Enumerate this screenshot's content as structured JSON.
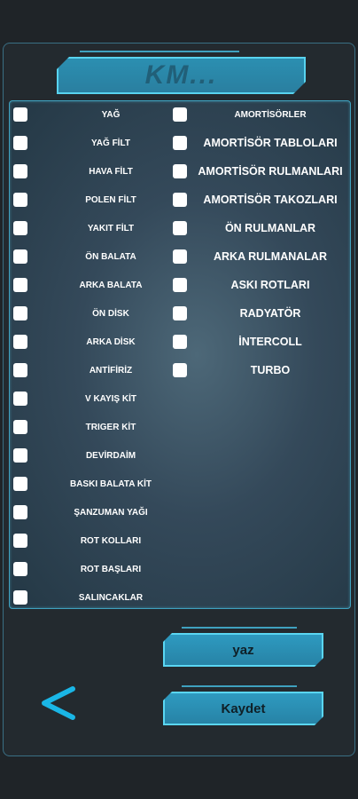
{
  "header": {
    "title": "KM..."
  },
  "left_items": [
    "YAĞ",
    "YAĞ FİLT",
    "HAVA FİLT",
    "POLEN FİLT",
    "YAKIT FİLT",
    "ÖN BALATA",
    "ARKA BALATA",
    "ÖN DİSK",
    "ARKA DİSK",
    "ANTİFİRİZ",
    "V KAYIŞ KİT",
    "TRIGER KİT",
    "DEVİRDAİM",
    "BASKI BALATA KİT",
    "ŞANZUMAN YAĞI",
    "ROT KOLLARI",
    "ROT BAŞLARI",
    "SALINCAKLAR"
  ],
  "right_items": [
    "AMORTİSÖRLER",
    "AMORTİSÖR TABLOLARI",
    "AMORTİSÖR RULMANLARI",
    "AMORTİSÖR TAKOZLARI",
    "ÖN RULMANLAR",
    "ARKA RULMANALAR",
    "ASKI ROTLARI",
    "RADYATÖR",
    "İNTERCOLL",
    "TURBO"
  ],
  "buttons": {
    "write_label": "yaz",
    "save_label": "Kaydet"
  },
  "icons": {
    "back": "back-arrow-icon"
  },
  "colors": {
    "accent": "#3fa1bf",
    "button": "#2e9ac0",
    "back_arrow": "#1ab6e6"
  }
}
